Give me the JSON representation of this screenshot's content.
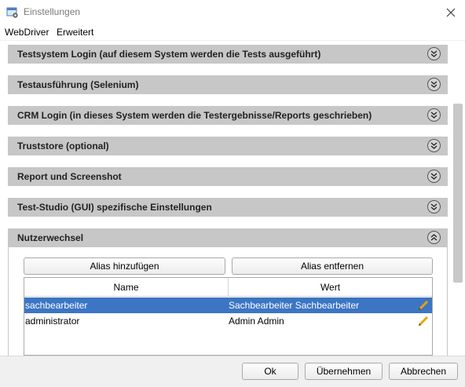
{
  "window": {
    "title": "Einstellungen"
  },
  "menu": {
    "items": [
      {
        "label": "WebDriver"
      },
      {
        "label": "Erweitert"
      }
    ]
  },
  "sections": [
    {
      "label": "Testsystem Login (auf diesem System werden die Tests ausgeführt)",
      "expanded": false
    },
    {
      "label": "Testausführung (Selenium)",
      "expanded": false
    },
    {
      "label": "CRM Login (in dieses System werden die Testergebnisse/Reports geschrieben)",
      "expanded": false
    },
    {
      "label": "Truststore (optional)",
      "expanded": false
    },
    {
      "label": "Report und Screenshot",
      "expanded": false
    },
    {
      "label": "Test-Studio (GUI) spezifische Einstellungen",
      "expanded": false
    },
    {
      "label": "Nutzerwechsel",
      "expanded": true
    }
  ],
  "nutzerwechsel": {
    "add_label": "Alias hinzufügen",
    "remove_label": "Alias entfernen",
    "table": {
      "columns": [
        "Name",
        "Wert"
      ],
      "rows": [
        {
          "name": "sachbearbeiter",
          "value": "Sachbearbeiter Sachbearbeiter",
          "selected": true
        },
        {
          "name": "administrator",
          "value": "Admin Admin",
          "selected": false
        }
      ]
    }
  },
  "footer": {
    "ok_label": "Ok",
    "apply_label": "Übernehmen",
    "cancel_label": "Abbrechen"
  },
  "colors": {
    "section_bg": "#c7c7c7",
    "selection": "#3c75c4",
    "edit_pencil": "#f0a000"
  },
  "icons": {
    "app": "settings-window-icon",
    "close": "close-icon",
    "collapse": "chevron-double-down-icon",
    "expand": "chevron-double-up-icon",
    "edit": "pencil-icon"
  }
}
